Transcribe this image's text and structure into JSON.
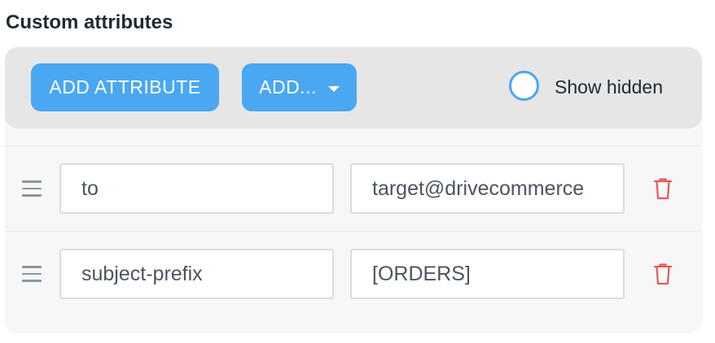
{
  "section": {
    "title": "Custom attributes"
  },
  "toolbar": {
    "add_attribute_label": "ADD ATTRIBUTE",
    "add_menu_label": "ADD...",
    "show_hidden_label": "Show hidden",
    "show_hidden_checked": false
  },
  "attributes": [
    {
      "key": "to",
      "value": "target@drivecommerce"
    },
    {
      "key": "subject-prefix",
      "value": "[ORDERS]"
    }
  ],
  "icons": {
    "drag": "drag-handle-icon",
    "delete": "trash-icon",
    "dropdown": "caret-down-icon"
  },
  "colors": {
    "accent": "#4aa7f2",
    "danger": "#e05a5a",
    "toolbar_bg": "#e6e6e6",
    "panel_bg": "#f7f7f7"
  }
}
